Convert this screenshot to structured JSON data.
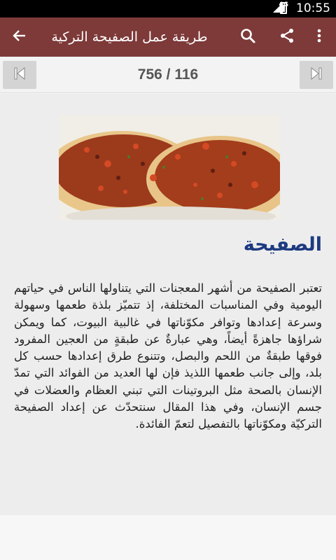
{
  "status_bar": {
    "time": "10:55",
    "network": "4G"
  },
  "app_bar": {
    "title": "طريقة عمل الصفيحة التركية",
    "icons": [
      "back-arrow-icon",
      "search-icon",
      "share-icon",
      "more-vert-icon"
    ]
  },
  "nav": {
    "page_counter": "756 / 116"
  },
  "article": {
    "heading": "الصفيحة",
    "body": "تعتبر الصفيحة من أشهر المعجنات التي يتناولها الناس في حياتهم اليومية وفي المناسبات المختلفة، إذ تتميّز بلذة طعمها وسهولة وسرعة إعدادها وتوافر مكوّناتها في غالبية البيوت، كما ويمكن شراؤها جاهزةً أيضاً، وهي عبارةٌ عن طبقةٍ من العجين المفرود فوقها طبقةٌ من اللحم والبصل، وتتنوع طرق إعدادها حسب كل بلد، وإلى جانب طعمها اللذيذ فإن لها العديد من الفوائد التي تمدّ الإنسان بالصحة مثل البروتينات التي تبني العظام والعضلات في جسم الإنسان، وفي هذا المقال سنتحدّث عن إعداد الصفيحة التركيّة ومكوّناتها بالتفصيل لتعمّ الفائدة."
  },
  "colors": {
    "app_bar": "#7d3a39",
    "heading": "#1d3a80"
  }
}
